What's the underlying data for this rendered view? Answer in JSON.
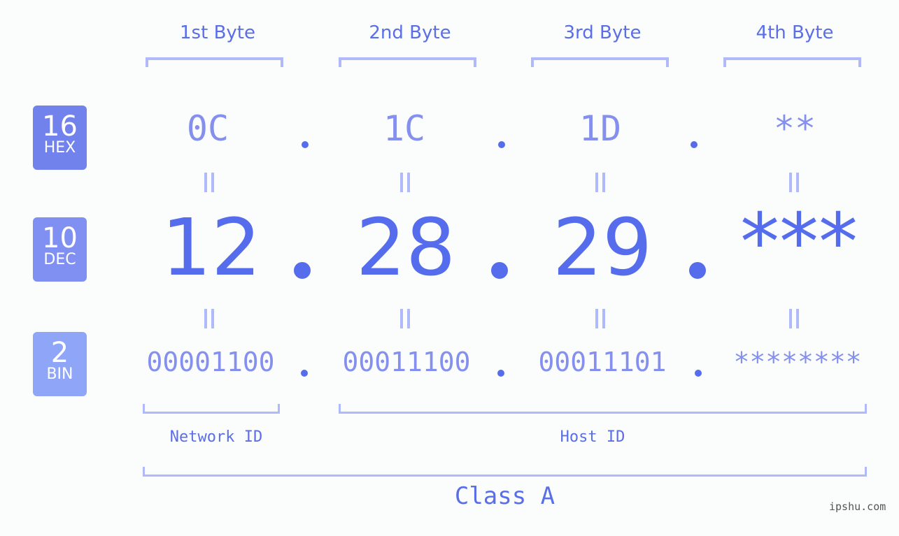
{
  "bytes": [
    {
      "label": "1st Byte",
      "hex": "0C",
      "dec": "12",
      "bin": "00001100"
    },
    {
      "label": "2nd Byte",
      "hex": "1C",
      "dec": "28",
      "bin": "00011100"
    },
    {
      "label": "3rd Byte",
      "hex": "1D",
      "dec": "29",
      "bin": "00011101"
    },
    {
      "label": "4th Byte",
      "hex": "**",
      "dec": "***",
      "bin": "********"
    }
  ],
  "badges": {
    "hex": {
      "num": "16",
      "label": "HEX",
      "color": "#7282ec"
    },
    "dec": {
      "num": "10",
      "label": "DEC",
      "color": "#8090f2"
    },
    "bin": {
      "num": "2",
      "label": "BIN",
      "color": "#8fa6f8"
    }
  },
  "segments": {
    "network": "Network ID",
    "host": "Host ID"
  },
  "ip_class": "Class A",
  "watermark": "ipshu.com",
  "colors": {
    "primary": "#556cec",
    "secondary": "#8590ee",
    "bracket": "#b0b9f9"
  }
}
